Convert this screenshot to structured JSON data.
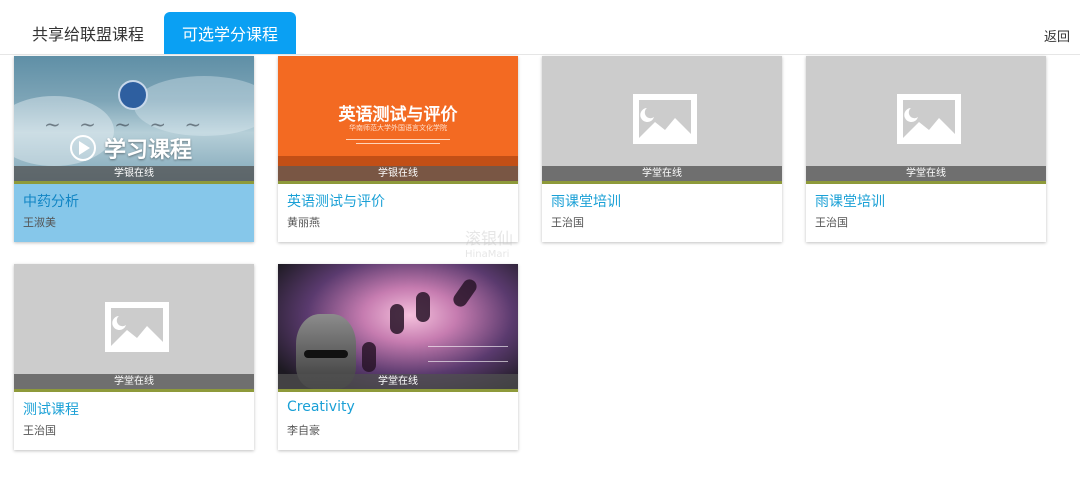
{
  "tabs": [
    {
      "label": "共享给联盟课程",
      "active": false
    },
    {
      "label": "可选学分课程",
      "active": true
    }
  ],
  "back_label": "返回",
  "colors": {
    "tab_active_bg": "#0aa0f3",
    "title_link": "#1aa0d6",
    "selected_card_bg": "#86c7ea"
  },
  "courses": [
    {
      "title": "中药分析",
      "teacher": "王淑美",
      "platform": "学银在线",
      "thumbnail": "blue-study-banner",
      "thumb_text": "学习课程",
      "selected": true
    },
    {
      "title": "英语测试与评价",
      "teacher": "黄丽燕",
      "platform": "学银在线",
      "thumbnail": "orange-title-banner",
      "thumb_text": "英语测试与评价",
      "thumb_subtext": "华南师范大学外国语言文化学院",
      "selected": false
    },
    {
      "title": "雨课堂培训",
      "teacher": "王治国",
      "platform": "学堂在线",
      "thumbnail": "image-placeholder-icon",
      "selected": false
    },
    {
      "title": "雨课堂培训",
      "teacher": "王治国",
      "platform": "学堂在线",
      "thumbnail": "image-placeholder-icon",
      "selected": false
    },
    {
      "title": "测试课程",
      "teacher": "王治国",
      "platform": "学堂在线",
      "thumbnail": "image-placeholder-icon",
      "selected": false
    },
    {
      "title": "Creativity",
      "teacher": "李自豪",
      "platform": "学堂在线",
      "thumbnail": "creativity-artwork",
      "selected": false
    }
  ],
  "watermark": {
    "cn": "滚银仙",
    "en": "HinaMari"
  }
}
